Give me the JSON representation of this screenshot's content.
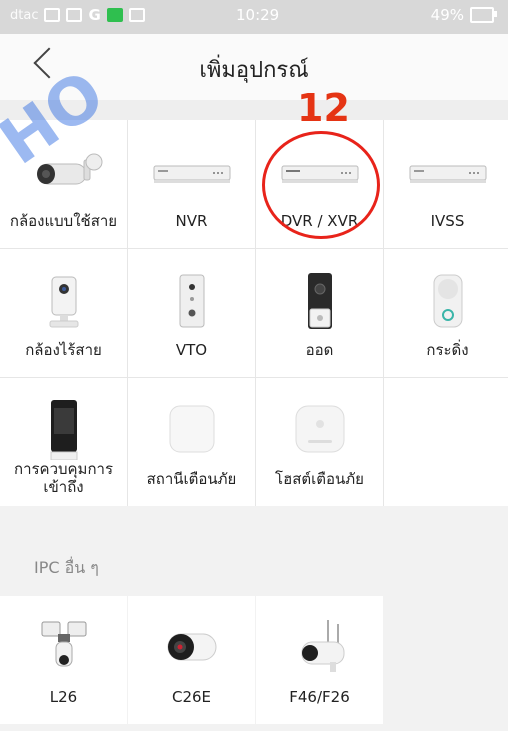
{
  "status_bar": {
    "carrier": "dtac",
    "time": "10:29",
    "battery": "49%"
  },
  "header": {
    "title": "เพิ่มอุปกรณ์"
  },
  "devices": [
    {
      "label": "กล้องแบบใช้สาย",
      "icon": "bullet-camera-icon"
    },
    {
      "label": "NVR",
      "icon": "nvr-box-icon"
    },
    {
      "label": "DVR / XVR",
      "icon": "dvr-box-icon"
    },
    {
      "label": "IVSS",
      "icon": "ivss-box-icon"
    },
    {
      "label": "กล้องไร้สาย",
      "icon": "cube-camera-icon"
    },
    {
      "label": "VTO",
      "icon": "vto-intercom-icon"
    },
    {
      "label": "ออด",
      "icon": "doorbell-icon"
    },
    {
      "label": "กระดิ่ง",
      "icon": "chime-icon"
    },
    {
      "label": "การควบคุมการเข้าถึง",
      "line1": "การควบคุมการ",
      "line2": "เข้าถึง",
      "icon": "access-control-icon"
    },
    {
      "label": "สถานีเตือนภัย",
      "icon": "alarm-station-icon"
    },
    {
      "label": "โฮสต์เตือนภัย",
      "icon": "alarm-hub-icon"
    }
  ],
  "section": {
    "label": "IPC อื่น ๆ"
  },
  "other_ipc": [
    {
      "label": "L26",
      "icon": "floodlight-camera-icon"
    },
    {
      "label": "C26E",
      "icon": "mini-bullet-camera-icon"
    },
    {
      "label": "F46/F26",
      "icon": "wifi-bullet-camera-icon"
    }
  ],
  "annotation": {
    "step_number": "12",
    "color": "#e53414"
  }
}
